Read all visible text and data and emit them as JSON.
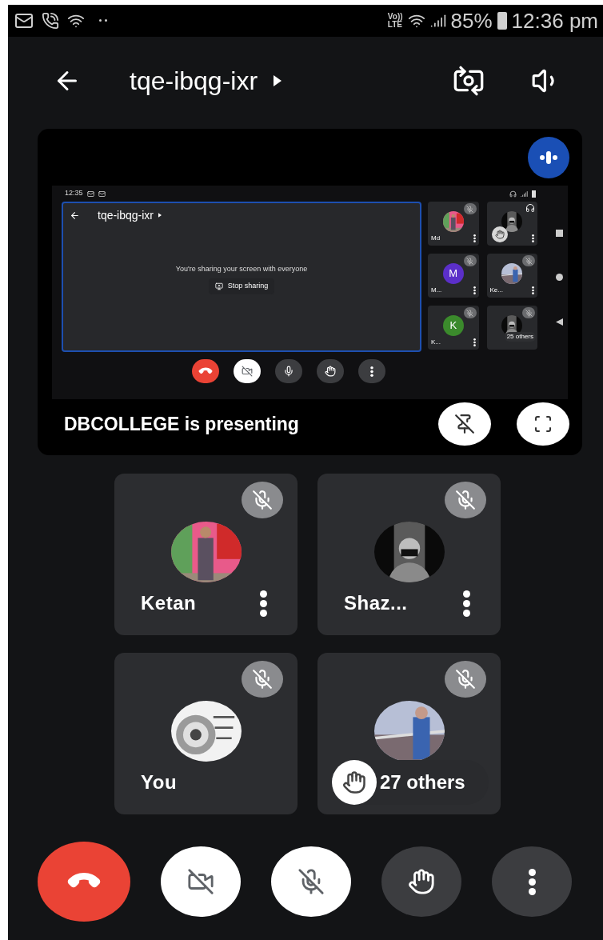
{
  "status_bar": {
    "network_top": "Vo))",
    "network_bottom": "LTE",
    "battery": "85%",
    "time": "12:36 pm"
  },
  "header": {
    "title": "tqe-ibqg-ixr"
  },
  "presentation": {
    "presenter_text": "DBCOLLEGE is presenting",
    "screen": {
      "time": "12:35",
      "title": "tqe-ibqg-ixr",
      "message": "You're sharing your screen with everyone",
      "stop_button": "Stop sharing",
      "tiles": [
        {
          "name": "Md",
          "kind": "picture",
          "muted": true,
          "headphones": false,
          "hand_raised": false
        },
        {
          "kind": "picture",
          "muted": false,
          "headphones": true,
          "hand_raised": true
        },
        {
          "name": "M...",
          "kind": "initial",
          "initial": "M",
          "color": "#5b2fc9",
          "muted": true,
          "headphones": false,
          "hand_raised": false
        },
        {
          "name": "Ke...",
          "kind": "picture",
          "muted": true,
          "headphones": false,
          "hand_raised": false
        },
        {
          "name": "K...",
          "kind": "initial",
          "initial": "K",
          "color": "#3b8a2c",
          "muted": true,
          "headphones": false,
          "hand_raised": false
        },
        {
          "kind": "picture",
          "muted": true,
          "headphones": false,
          "hand_raised": false,
          "label": "25 others"
        }
      ],
      "controls": [
        {
          "kind": "end_call"
        },
        {
          "kind": "camera",
          "on": false
        },
        {
          "kind": "mic",
          "on": true
        },
        {
          "kind": "hand"
        },
        {
          "kind": "more"
        }
      ]
    }
  },
  "participants": [
    {
      "name": "Ketan",
      "muted": true,
      "menu": true
    },
    {
      "name": "Shaz...",
      "muted": true,
      "menu": true
    },
    {
      "name": "You",
      "muted": true,
      "menu": false
    },
    {
      "muted": true,
      "menu": false,
      "overlay": {
        "label": "27 others",
        "hand_raised": true
      }
    }
  ],
  "controls": [
    {
      "kind": "end_call"
    },
    {
      "kind": "camera",
      "on": false
    },
    {
      "kind": "mic",
      "on": false
    },
    {
      "kind": "hand"
    },
    {
      "kind": "more"
    }
  ]
}
